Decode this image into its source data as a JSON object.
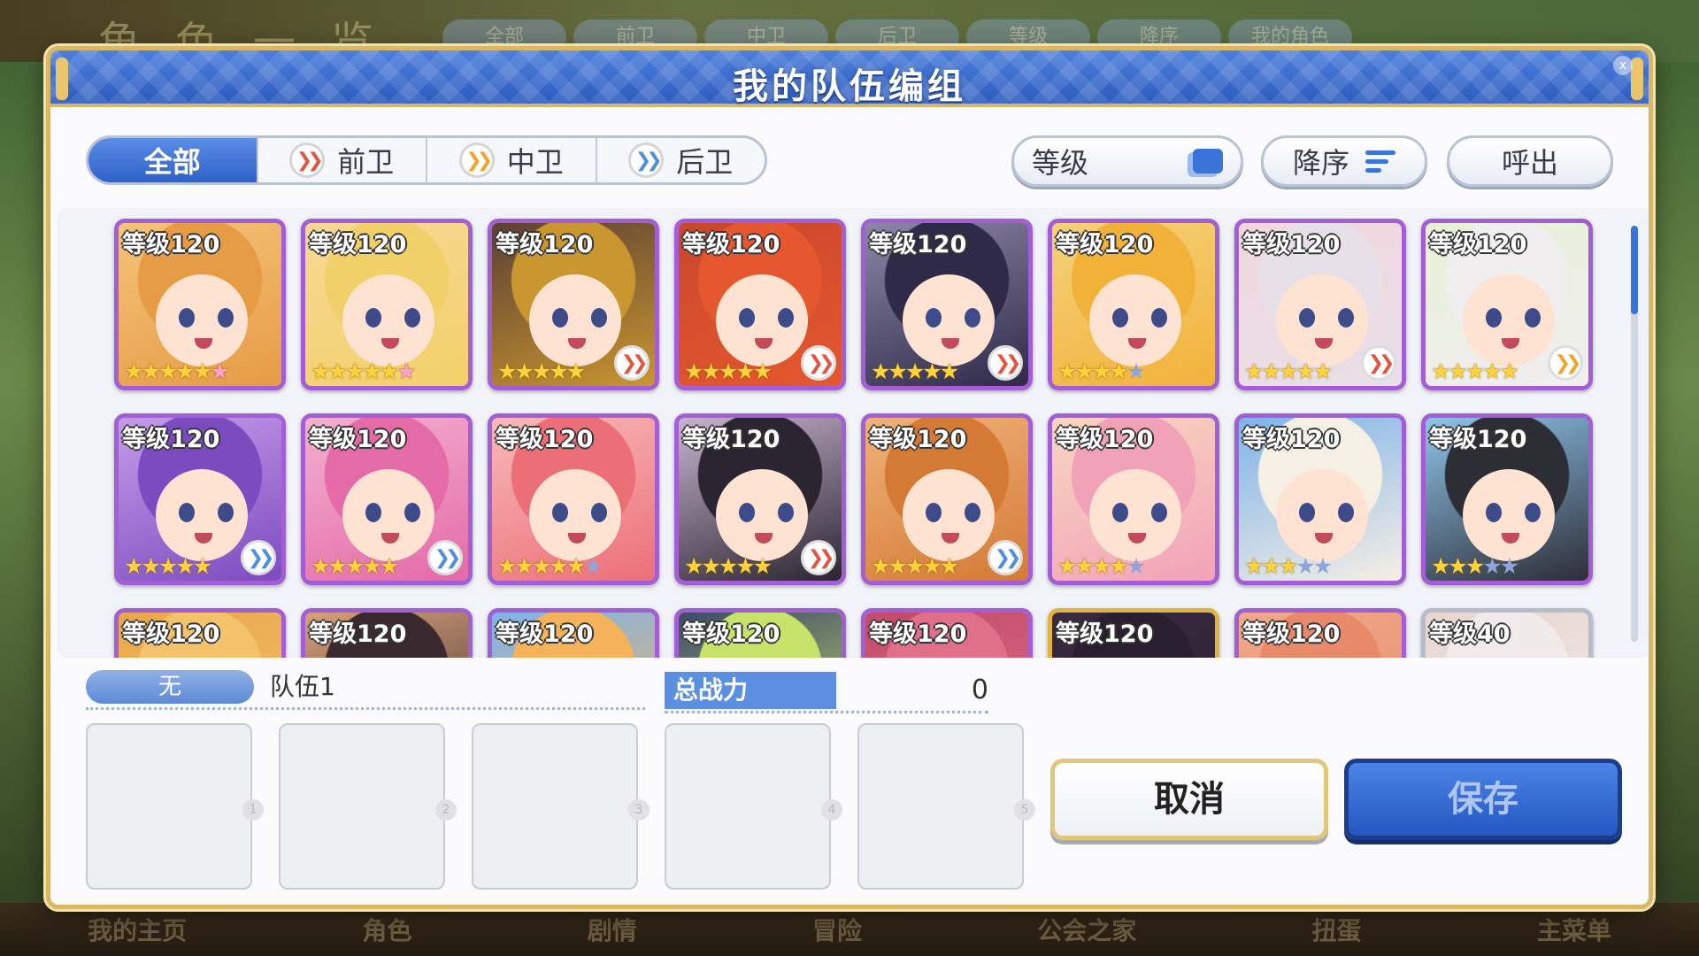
{
  "background": {
    "title": "角色一览",
    "top_tabs": [
      "全部",
      "前卫",
      "中卫",
      "后卫",
      "等级",
      "降序",
      "我的角色"
    ],
    "bottom_nav": [
      "我的主页",
      "角色",
      "剧情",
      "冒险",
      "公会之家",
      "扭蛋",
      "主菜单"
    ]
  },
  "dialog": {
    "title": "我的队伍编组",
    "close_label": "x"
  },
  "filters": {
    "tabs": [
      {
        "label": "全部",
        "icon": "none",
        "active": true
      },
      {
        "label": "前卫",
        "icon": "front-role-icon",
        "active": false
      },
      {
        "label": "中卫",
        "icon": "mid-role-icon",
        "active": false
      },
      {
        "label": "后卫",
        "icon": "back-role-icon",
        "active": false
      }
    ],
    "sort_key": "等级",
    "sort_order": "降序",
    "recall": "呼出"
  },
  "characters": [
    {
      "level": "等级120",
      "stars": 5,
      "max_stars": 6,
      "sixth": "pink",
      "role": "none",
      "frame": "purple",
      "hair": "#e69b45",
      "bg": "#f5c37a"
    },
    {
      "level": "等级120",
      "stars": 5,
      "max_stars": 6,
      "sixth": "pink",
      "role": "none",
      "frame": "purple",
      "hair": "#f2d069",
      "bg": "#f7d995"
    },
    {
      "level": "等级120",
      "stars": 5,
      "max_stars": 5,
      "sixth": "",
      "role": "front",
      "frame": "purple",
      "hair": "#c9962f",
      "bg": "#5c4033"
    },
    {
      "level": "等级120",
      "stars": 5,
      "max_stars": 5,
      "sixth": "",
      "role": "front",
      "frame": "purple",
      "hair": "#e5582f",
      "bg": "#c9462c"
    },
    {
      "level": "等级120",
      "stars": 5,
      "max_stars": 5,
      "sixth": "",
      "role": "front",
      "frame": "purple",
      "hair": "#2e2a48",
      "bg": "#8e86a8"
    },
    {
      "level": "等级120",
      "stars": 4,
      "max_stars": 5,
      "sixth": "",
      "role": "none",
      "frame": "purple",
      "hair": "#f2b23a",
      "bg": "#f5d17a"
    },
    {
      "level": "等级120",
      "stars": 5,
      "max_stars": 5,
      "sixth": "",
      "role": "front",
      "frame": "purple",
      "hair": "#e8e0e8",
      "bg": "#f2d6de"
    },
    {
      "level": "等级120",
      "stars": 5,
      "max_stars": 5,
      "sixth": "",
      "role": "mid",
      "frame": "purple",
      "hair": "#f1eef0",
      "bg": "#e7f0d6"
    },
    {
      "level": "等级120",
      "stars": 5,
      "max_stars": 5,
      "sixth": "",
      "role": "back",
      "frame": "purple",
      "hair": "#7a4cc0",
      "bg": "#c79be8"
    },
    {
      "level": "等级120",
      "stars": 5,
      "max_stars": 5,
      "sixth": "",
      "role": "back",
      "frame": "purple",
      "hair": "#e46aa8",
      "bg": "#f3b0cf"
    },
    {
      "level": "等级120",
      "stars": 5,
      "max_stars": 6,
      "sixth": "off",
      "role": "none",
      "frame": "purple",
      "hair": "#ec6f78",
      "bg": "#f7b9b9"
    },
    {
      "level": "等级120",
      "stars": 5,
      "max_stars": 5,
      "sixth": "",
      "role": "front",
      "frame": "purple",
      "hair": "#2a2530",
      "bg": "#c8b3cf"
    },
    {
      "level": "等级120",
      "stars": 5,
      "max_stars": 5,
      "sixth": "",
      "role": "back",
      "frame": "purple",
      "hair": "#d47a35",
      "bg": "#f0b27a"
    },
    {
      "level": "等级120",
      "stars": 4,
      "max_stars": 5,
      "sixth": "",
      "role": "none",
      "frame": "purple",
      "hair": "#f2a2b8",
      "bg": "#f7d6c0"
    },
    {
      "level": "等级120",
      "stars": 3,
      "max_stars": 5,
      "sixth": "",
      "role": "none",
      "frame": "purple",
      "hair": "#f6efe4",
      "bg": "#7fb3ea"
    },
    {
      "level": "等级120",
      "stars": 3,
      "max_stars": 5,
      "sixth": "",
      "role": "none",
      "frame": "purple",
      "hair": "#2d2d36",
      "bg": "#8ec4ea"
    },
    {
      "level": "等级120",
      "stars": 0,
      "max_stars": 0,
      "sixth": "",
      "role": "none",
      "frame": "purple",
      "hair": "#f3c26a",
      "bg": "#e9a74c"
    },
    {
      "level": "等级120",
      "stars": 0,
      "max_stars": 0,
      "sixth": "",
      "role": "none",
      "frame": "purple",
      "hair": "#3a2a30",
      "bg": "#d8a07a"
    },
    {
      "level": "等级120",
      "stars": 0,
      "max_stars": 0,
      "sixth": "",
      "role": "none",
      "frame": "purple",
      "hair": "#f4b35a",
      "bg": "#7fb3ea"
    },
    {
      "level": "等级120",
      "stars": 0,
      "max_stars": 0,
      "sixth": "",
      "role": "none",
      "frame": "purple",
      "hair": "#c8e36a",
      "bg": "#3d4a6a"
    },
    {
      "level": "等级120",
      "stars": 0,
      "max_stars": 0,
      "sixth": "",
      "role": "none",
      "frame": "purple",
      "hair": "#e0708a",
      "bg": "#c24a6a"
    },
    {
      "level": "等级120",
      "stars": 0,
      "max_stars": 0,
      "sixth": "",
      "role": "none",
      "frame": "gold",
      "hair": "#2a1f30",
      "bg": "#3a2a40"
    },
    {
      "level": "等级120",
      "stars": 0,
      "max_stars": 0,
      "sixth": "",
      "role": "none",
      "frame": "purple",
      "hair": "#e88a6a",
      "bg": "#f0a88a"
    },
    {
      "level": "等级40",
      "stars": 0,
      "max_stars": 0,
      "sixth": "",
      "role": "none",
      "frame": "silver",
      "hair": "#f0eaea",
      "bg": "#e8d6d0"
    }
  ],
  "team": {
    "tag": "无",
    "name": "队伍1",
    "power_label": "总战力",
    "power_value": "0",
    "slot_numbers": [
      "1",
      "2",
      "3",
      "4",
      "5"
    ]
  },
  "actions": {
    "cancel": "取消",
    "save": "保存"
  },
  "colors": {
    "accent_blue": "#2f62c8",
    "frame_gold": "#d8b766",
    "frame_purple": "#a35ed6"
  }
}
